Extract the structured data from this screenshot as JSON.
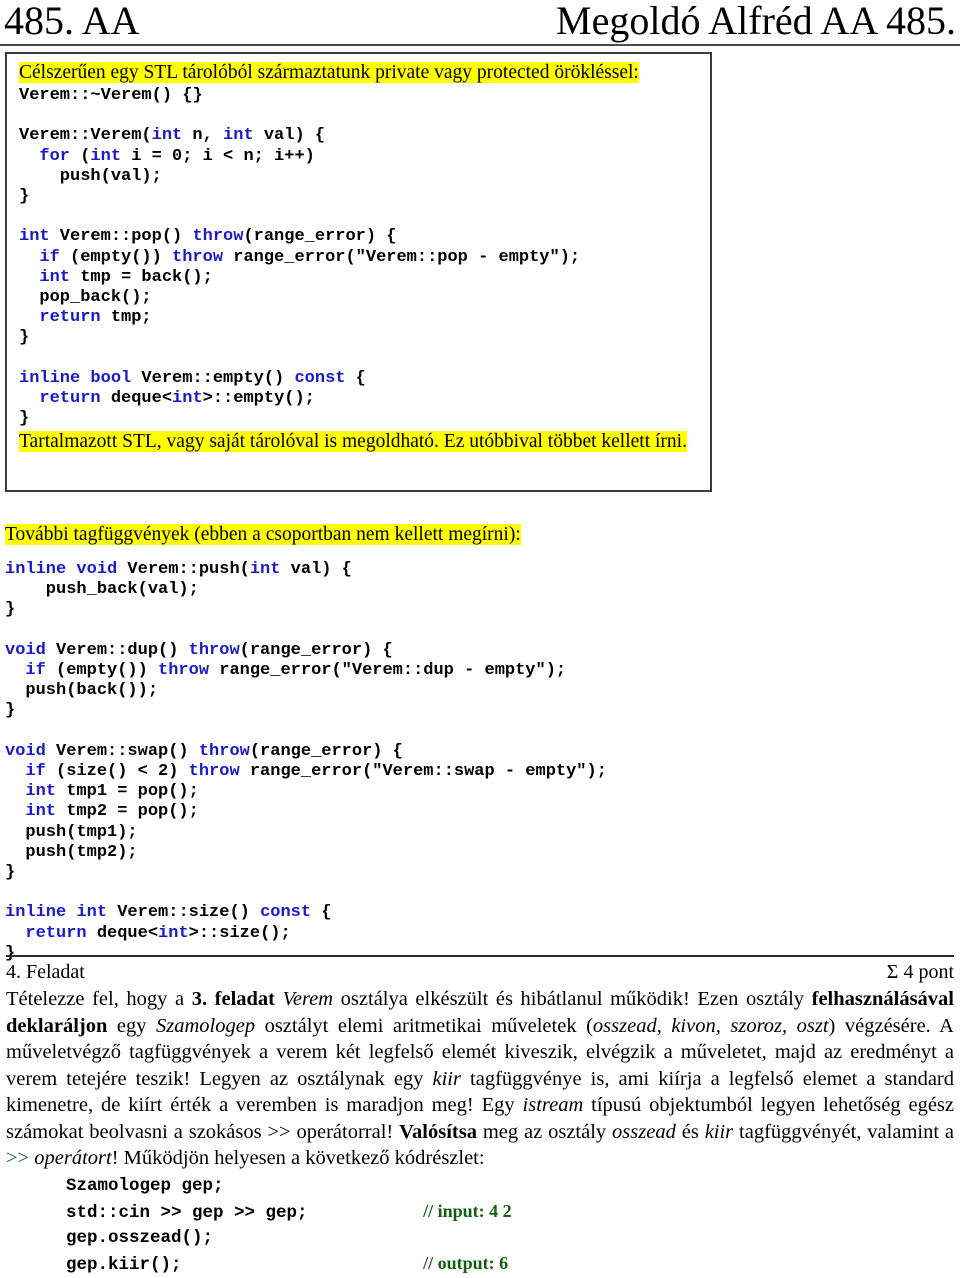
{
  "header": {
    "left": "485. AA",
    "right": "Megoldó Alfréd AA 485."
  },
  "codebox": {
    "highlight_top": "Célszerűen egy STL tárolóból származtatunk private vagy protected  örökléssel:",
    "highlight_bottom": "Tartalmazott STL, vagy saját tárolóval is megoldható. Ez utóbbival többet kellett írni.",
    "code_lines": [
      "Verem::~Verem() {}",
      "",
      "Verem::Verem(int n, int val) {",
      "  for (int i = 0; i < n; i++)",
      "    push(val);",
      "}",
      "",
      "int Verem::pop() throw(range_error) {",
      "  if (empty()) throw range_error(\"Verem::pop - empty\");",
      "  int tmp = back();",
      "  pop_back();",
      "  return tmp;",
      "}",
      "",
      "inline bool Verem::empty() const {",
      "  return deque<int>::empty();",
      "}"
    ]
  },
  "middle": {
    "highlight": "További tagfüggvények (ebben a csoportban nem kellett megírni):",
    "code_lines": [
      "inline void Verem::push(int val) {",
      "    push_back(val);",
      "}",
      "",
      "void Verem::dup() throw(range_error) {",
      "  if (empty()) throw range_error(\"Verem::dup - empty\");",
      "  push(back());",
      "}",
      "",
      "void Verem::swap() throw(range_error) {",
      "  if (size() < 2) throw range_error(\"Verem::swap - empty\");",
      "  int tmp1 = pop();",
      "  int tmp2 = pop();",
      "  push(tmp1);",
      "  push(tmp2);",
      "}",
      "",
      "inline int Verem::size() const {",
      "  return deque<int>::size();",
      "}"
    ]
  },
  "task": {
    "title": "4. Feladat",
    "points": "Σ 4 pont",
    "paragraph_html": "Tételezze fel, hogy a <b>3. feladat</b> <i>Verem</i> osztálya elkészült és hibátlanul működik! Ezen osztály <b>felhasználásával deklaráljon</b> egy <i>Szamologep</i> osztályt elemi aritmetikai műveletek (<i>osszead, kivon, szoroz, oszt</i>) végzésére. A műveletvégző tagfüggvények a verem két legfelső elemét kiveszik, elvégzik a műveletet, majd az eredményt a verem tetejére teszik! Legyen az osztálynak egy <i>kiir</i> tagfüggvénye is, ami kiírja a legfelső elemet a standard kimenetre, de kiírt érték a veremben is maradjon meg! Egy <i>istream</i> típusú objektumból legyen lehetőség egész számokat beolvasni a szokásos &gt;&gt; operátorral! <b>Valósítsa</b> meg az osztály <i>osszead</i> és <i>kiir</i> tagfüggvényét, valamint a <span style=\"color:#136013\">&gt;&gt;</span> <i>operátort</i>! Működjön helyesen a következő kódrészlet:",
    "snippet_rows": [
      {
        "code": "Szamologep gep;",
        "comment": ""
      },
      {
        "code": "std::cin >> gep >> gep;",
        "comment": "// input: 4 2"
      },
      {
        "code": "gep.osszead();",
        "comment": ""
      },
      {
        "code": "gep.kiir();",
        "comment": "// output: 6"
      }
    ]
  },
  "colors": {
    "keyword_blue": "#1a1aca",
    "comment_green": "#136013",
    "highlight_yellow": "#ffff00",
    "rule_gray": "#3c3c3c"
  }
}
